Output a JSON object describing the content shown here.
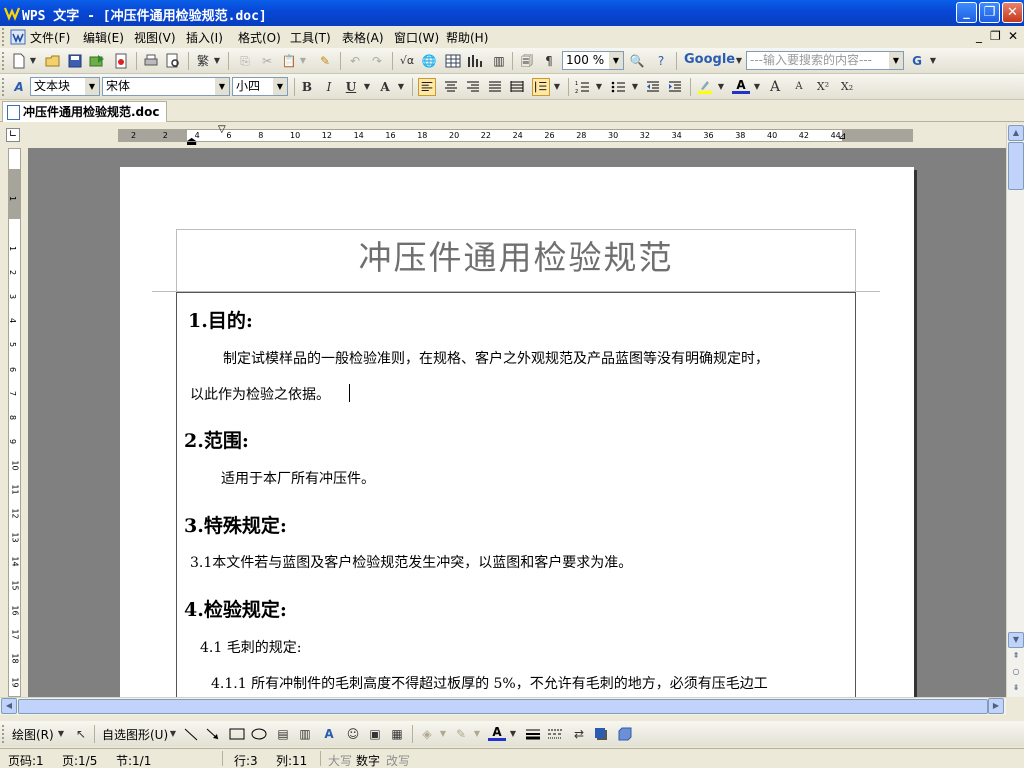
{
  "window": {
    "title": "WPS 文字 - [冲压件通用检验规范.doc]",
    "controls": [
      "_",
      "❐",
      "✕"
    ]
  },
  "menubar": {
    "items": [
      "文件(F)",
      "编辑(E)",
      "视图(V)",
      "插入(I)",
      "格式(O)",
      "工具(T)",
      "表格(A)",
      "窗口(W)",
      "帮助(H)"
    ],
    "doc_controls": [
      "_",
      "❐",
      "✕"
    ]
  },
  "toolbar1": {
    "zoom": "100 %",
    "search_engine": "Google",
    "search_placeholder": "---输入要搜索的内容---"
  },
  "toolbar2": {
    "style": "文本块",
    "font": "宋体",
    "size": "小四",
    "bold": "B",
    "italic": "I",
    "underline": "U",
    "font_color_letter": "A",
    "grow": "A",
    "shrink": "A",
    "superscript": "X²",
    "subscript": "X₂"
  },
  "tab": {
    "label": "冲压件通用检验规范.doc"
  },
  "ruler": {
    "h_ticks": [
      "2",
      "2",
      "4",
      "6",
      "8",
      "10",
      "12",
      "14",
      "16",
      "18",
      "20",
      "22",
      "24",
      "26",
      "28",
      "30",
      "32",
      "34",
      "36",
      "38",
      "40",
      "42",
      "44"
    ],
    "v_ticks": [
      "1",
      "1",
      "2",
      "3",
      "4",
      "5",
      "6",
      "7",
      "8",
      "9",
      "10",
      "11",
      "12",
      "13",
      "14",
      "15",
      "16",
      "17",
      "18",
      "19"
    ]
  },
  "document": {
    "title": "冲压件通用检验规范",
    "sections": [
      {
        "heading": "1.目的:",
        "paragraphs": [
          "制定试模样品的一般检验准则，在规格、客户之外观规范及产品蓝图等没有明确规定时，",
          "以此作为检验之依据。"
        ]
      },
      {
        "heading": "2.范围:",
        "paragraphs": [
          "适用于本厂所有冲压件。"
        ]
      },
      {
        "heading": "3.特殊规定:",
        "paragraphs": [
          "3.1本文件若与蓝图及客户检验规范发生冲突，以蓝图和客户要求为准。"
        ]
      },
      {
        "heading": "4.检验规定:",
        "paragraphs": [
          "4.1 毛刺的规定:",
          "4.1.1 所有冲制件的毛刺高度不得超过板厚的 5%，不允许有毛刺的地方，必须有压毛边工"
        ]
      }
    ]
  },
  "drawbar": {
    "draw_label": "绘图(R)",
    "autoshape_label": "自选图形(U)"
  },
  "statusbar": {
    "page_code": "页码:1",
    "page": "页:1/5",
    "section": "节:1/1",
    "line": "行:3",
    "column": "列:11",
    "caps": "大写",
    "num": "数字",
    "overwrite": "改写"
  },
  "colors": {
    "titlebar": "#0A5FE8",
    "chrome": "#ECE9D8",
    "workspace": "#808080",
    "title_text": "#6F6F6F"
  }
}
